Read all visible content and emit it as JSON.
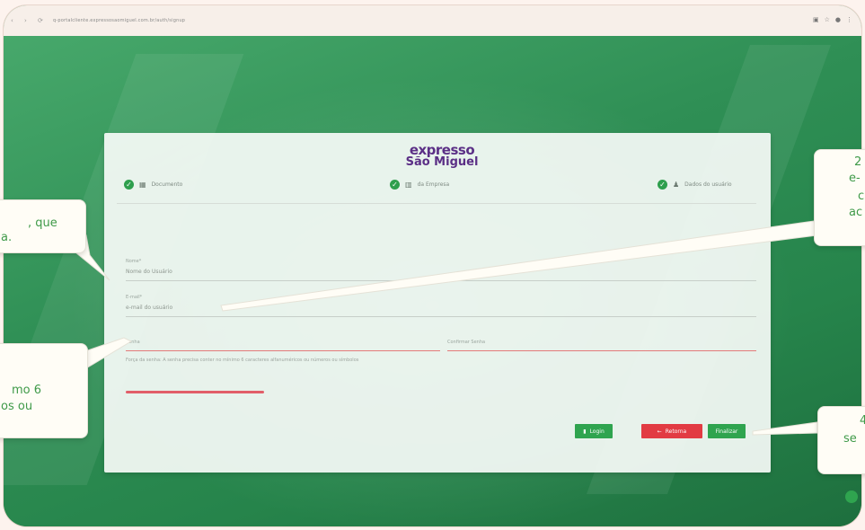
{
  "browser": {
    "url": "q-portalcliente.expressosaomiguel.com.br/auth/signup",
    "icons": [
      "back-icon",
      "forward-icon",
      "reload-icon",
      "extensions-icon",
      "star-icon",
      "profile-icon",
      "menu-icon"
    ]
  },
  "logo": {
    "line1": "expresso",
    "line2": "São Miguel"
  },
  "steps": [
    {
      "label": "Documento",
      "icon": "document-icon"
    },
    {
      "label": "da Empresa",
      "icon": "building-icon"
    },
    {
      "label": "Dados do usuário",
      "icon": "user-icon"
    }
  ],
  "form": {
    "name": {
      "label": "Nome*",
      "value": "Nome do Usuário"
    },
    "email": {
      "label": "E-mail*",
      "value": "e-mail do usuário"
    },
    "password": {
      "label": "Senha"
    },
    "confirm_password": {
      "label": "Confirmar Senha"
    },
    "hint": "Força da senha: A senha precisa conter no mínimo 6 caracteres alfanuméricos ou números ou símbolos",
    "strength_fraction": 0.22
  },
  "buttons": {
    "login": "Login",
    "back": "Retorna",
    "finish": "Finalizar"
  },
  "callouts": {
    "c1_line1": ", que",
    "c1_line2": "a.",
    "c2_line1": "2",
    "c2_line2": "e-",
    "c2_line3": "c",
    "c2_line4": "ac",
    "c3_line1": "mo 6",
    "c3_line2": "os ou",
    "c4_line1": "4",
    "c4_line2": "se"
  },
  "colors": {
    "accent_green": "#2fa44f",
    "danger_red": "#e23b43",
    "brand_purple": "#5b2f86",
    "callout_text": "#3f9a49"
  }
}
